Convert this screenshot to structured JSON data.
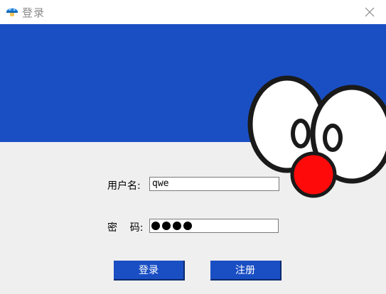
{
  "window": {
    "title": "登录",
    "icon": "mushroom-icon",
    "close_icon": "close-icon"
  },
  "banner": {
    "color": "#1a4fc4",
    "art": "doraemon-face"
  },
  "form": {
    "username_label": "用户名:",
    "username_value": "qwe",
    "password_label": "密    码:",
    "password_length": 4
  },
  "buttons": {
    "login_label": "登录",
    "register_label": "注册"
  }
}
